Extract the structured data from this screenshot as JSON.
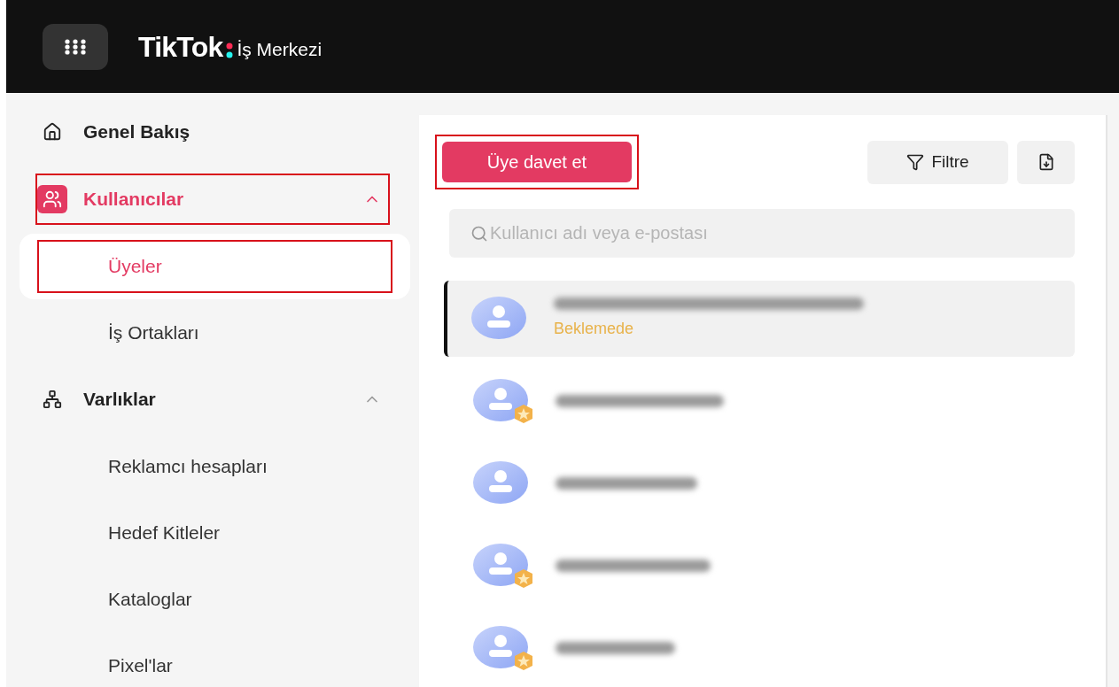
{
  "header": {
    "brand": "TikTok",
    "product": "İş Merkezi"
  },
  "sidebar": {
    "items": [
      {
        "label": "Genel Bakış",
        "kind": "link",
        "selected": false,
        "highlighted": false
      },
      {
        "label": "Kullanıcılar",
        "kind": "group",
        "selected": true,
        "expanded": true,
        "highlighted": true,
        "children": [
          {
            "label": "Üyeler",
            "selected": true,
            "highlighted": true
          },
          {
            "label": "İş Ortakları",
            "selected": false,
            "highlighted": false
          }
        ]
      },
      {
        "label": "Varlıklar",
        "kind": "group",
        "selected": false,
        "expanded": true,
        "highlighted": false,
        "children": [
          {
            "label": "Reklamcı hesapları",
            "selected": false,
            "highlighted": false
          },
          {
            "label": "Hedef Kitleler",
            "selected": false,
            "highlighted": false
          },
          {
            "label": "Kataloglar",
            "selected": false,
            "highlighted": false
          },
          {
            "label": "Pixel'lar",
            "selected": false,
            "highlighted": false
          }
        ]
      }
    ]
  },
  "toolbar": {
    "invite_button": {
      "label": "Üye davet et",
      "highlighted": true
    },
    "filter_button": {
      "label": "Filtre"
    }
  },
  "search": {
    "placeholder": "Kullanıcı adı veya e-postası"
  },
  "members": [
    {
      "status": "Beklemede",
      "admin": false,
      "selected": true
    },
    {
      "admin": true,
      "selected": false
    },
    {
      "admin": false,
      "selected": false
    },
    {
      "admin": true,
      "selected": false
    },
    {
      "admin": true,
      "selected": false
    }
  ]
}
